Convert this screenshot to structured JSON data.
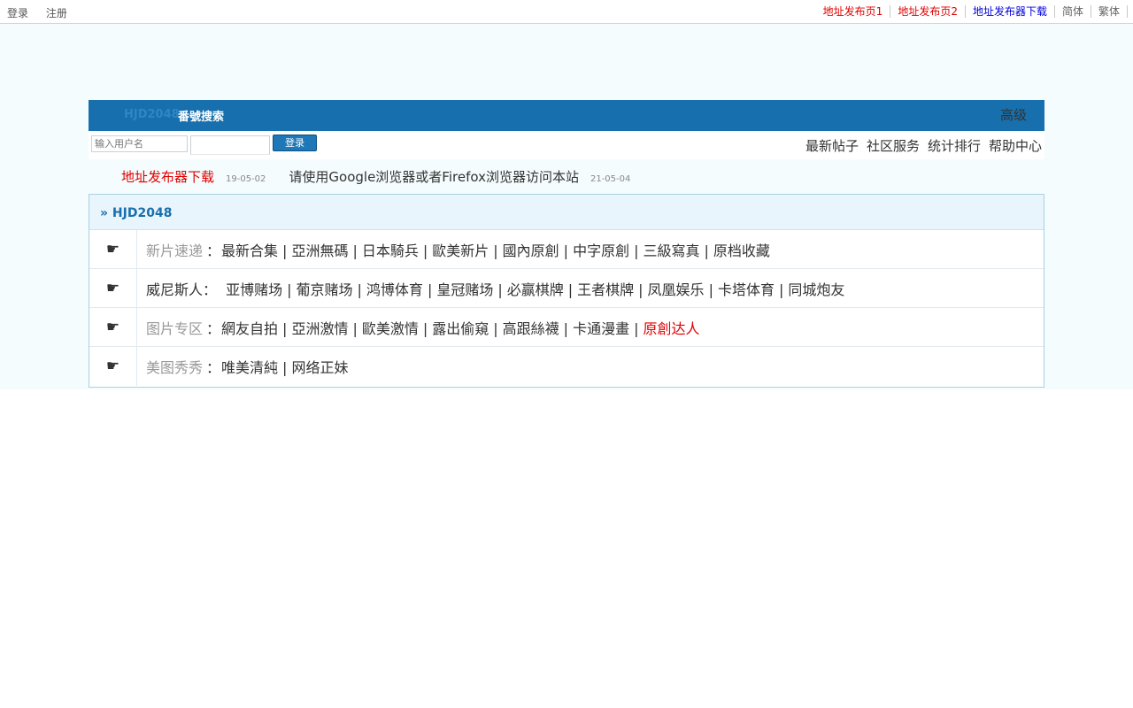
{
  "topbar": {
    "login": "登录",
    "register": "注册",
    "links": [
      {
        "label": "地址发布页1",
        "color": "#e00000"
      },
      {
        "label": "地址发布页2",
        "color": "#e00000"
      },
      {
        "label": "地址发布器下载",
        "color": "#0000dd"
      },
      {
        "label": "简体",
        "color": "#666666"
      },
      {
        "label": "繁体",
        "color": "#666666"
      }
    ]
  },
  "header": {
    "brand": "HJD2048",
    "search_tab": "番號搜索",
    "advanced": "高级"
  },
  "login": {
    "username_placeholder": "输入用户名",
    "submit": "登录"
  },
  "nav": [
    "最新帖子",
    "社区服务",
    "统计排行",
    "帮助中心"
  ],
  "announcements": [
    {
      "title": "地址发布器下载",
      "date": "19-05-02"
    },
    {
      "title": "请使用Google浏览器或者Firefox浏览器访问本站",
      "date": "21-05-04"
    }
  ],
  "forum": {
    "title": "» HJD2048",
    "icon": "☛",
    "rows": [
      {
        "category": "新片速递",
        "sep": "：",
        "links": [
          "最新合集",
          "亞洲無碼",
          "日本騎兵",
          "歐美新片",
          "國內原創",
          "中字原創",
          "三級寫真",
          "原档收藏"
        ]
      },
      {
        "category": "威尼斯人：",
        "sep": " ",
        "links": [
          "亚博赌场",
          "葡京赌场",
          "鸿博体育",
          "皇冠赌场",
          "必赢棋牌",
          "王者棋牌",
          "凤凰娱乐",
          "卡塔体育",
          "同城炮友"
        ]
      },
      {
        "category": "图片专区",
        "sep": "：",
        "links": [
          "網友自拍",
          "亞洲激情",
          "歐美激情",
          "露出偷窺",
          "高跟絲襪",
          "卡通漫畫",
          "原創达人"
        ]
      },
      {
        "category": "美图秀秀",
        "sep": "：",
        "links": [
          "唯美清純",
          "网络正妹"
        ]
      }
    ],
    "pipe": "|"
  }
}
